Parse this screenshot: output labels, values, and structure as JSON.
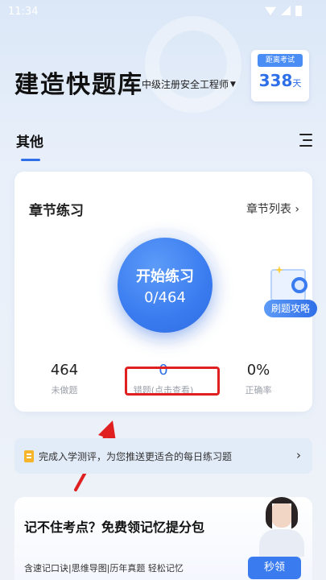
{
  "status_bar": {
    "time": "11:34"
  },
  "header": {
    "app_title": "建造快题库",
    "exam_name": "中级注册安全工程师",
    "countdown": {
      "label": "距离考试",
      "value": "338",
      "unit": "天"
    }
  },
  "tabs": {
    "current": "其他"
  },
  "practice_card": {
    "title": "章节练习",
    "list_link": "章节列表 ›",
    "start_label": "开始练习",
    "progress": "0/464",
    "stats": [
      {
        "value": "464",
        "label": "未做题"
      },
      {
        "value": "0",
        "label": "错题(点击查看)"
      },
      {
        "value": "0%",
        "label": "正确率"
      }
    ]
  },
  "float_badge": {
    "label": "刷题攻略"
  },
  "notice": {
    "text": "完成入学测评，为您推送更适合的每日练习题",
    "arrow": "›"
  },
  "promo": {
    "title": "记不住考点？免费领记忆提分包",
    "subtitle": "含速记口诀|思维导图|历年真题 轻松记忆",
    "button": "秒领"
  },
  "colors": {
    "accent": "#2f6fe8",
    "annotation": "#e02020"
  }
}
